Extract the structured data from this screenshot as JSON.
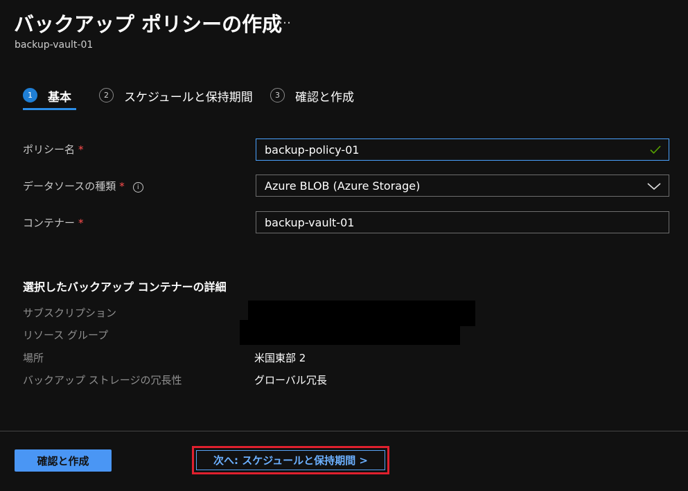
{
  "header": {
    "title": "バックアップ ポリシーの作成",
    "more": "…",
    "subtitle": "backup-vault-01"
  },
  "tabs": [
    {
      "number": "1",
      "label": "基本",
      "active": true
    },
    {
      "number": "2",
      "label": "スケジュールと保持期間",
      "active": false
    },
    {
      "number": "3",
      "label": "確認と作成",
      "active": false
    }
  ],
  "form": {
    "required_marker": "*",
    "policy_name": {
      "label": "ポリシー名",
      "value": "backup-policy-01"
    },
    "datasource": {
      "label": "データソースの種類",
      "value": "Azure BLOB (Azure Storage)",
      "info": "i"
    },
    "container": {
      "label": "コンテナー",
      "value": "backup-vault-01"
    }
  },
  "details": {
    "title": "選択したバックアップ コンテナーの詳細",
    "subscription": {
      "label": "サブスクリプション"
    },
    "resource_group": {
      "label": "リソース グループ"
    },
    "location": {
      "label": "場所",
      "value": "米国東部 2"
    },
    "redundancy": {
      "label": "バックアップ ストレージの冗長性",
      "value": "グローバル冗長"
    }
  },
  "footer": {
    "review_button": "確認と作成",
    "next_button": "次へ: スケジュールと保持期間 >"
  },
  "colors": {
    "background": "#111111",
    "accent": "#1f7fd6",
    "required": "#ff4d4d",
    "check": "#57a300",
    "highlight": "#e0202e"
  }
}
